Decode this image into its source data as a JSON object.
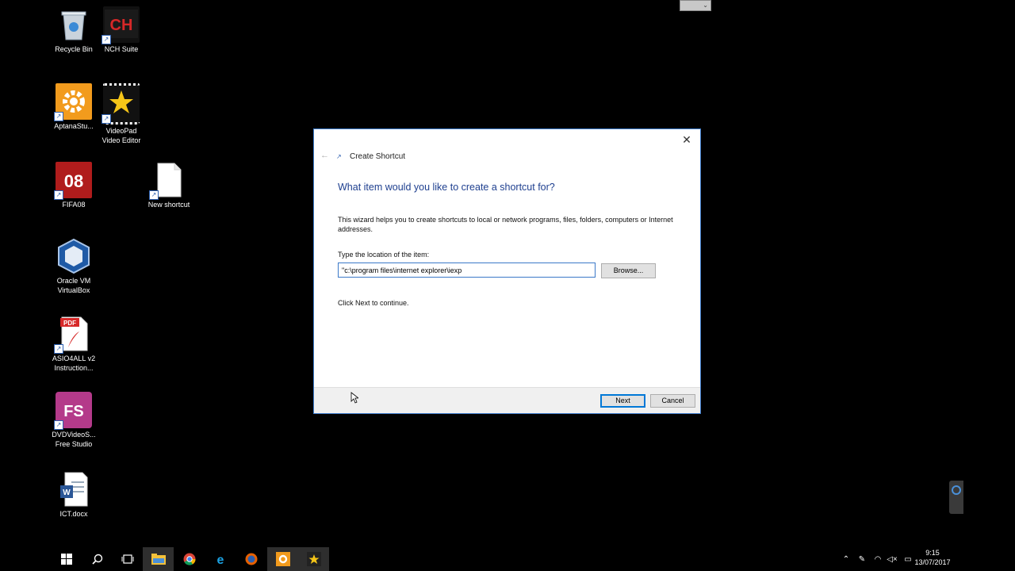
{
  "desktop": {
    "icons": [
      {
        "label": "Recycle Bin",
        "icon": "recycle-bin-icon"
      },
      {
        "label": "NCH Suite",
        "icon": "nch-suite-icon"
      },
      {
        "label": "AptanaStu...",
        "icon": "aptana-studio-icon"
      },
      {
        "label": "VideoPad\nVideo Editor",
        "icon": "videopad-icon"
      },
      {
        "label": "FIFA08",
        "icon": "fifa08-icon"
      },
      {
        "label": "New shortcut",
        "icon": "new-shortcut-icon"
      },
      {
        "label": "Oracle VM\nVirtualBox",
        "icon": "virtualbox-icon"
      },
      {
        "label": "ASIO4ALL v2\nInstruction...",
        "icon": "pdf-icon"
      },
      {
        "label": "DVDVideoS...\nFree Studio",
        "icon": "free-studio-icon"
      },
      {
        "label": "ICT.docx",
        "icon": "word-doc-icon"
      }
    ],
    "ncs_glyph": "CH",
    "fifa_glyph": "08",
    "pdf_glyph": "PDF",
    "fs_glyph": "FS",
    "word_glyph": "W"
  },
  "dialog": {
    "title": "Create Shortcut",
    "heading": "What item would you like to create a shortcut for?",
    "description": "This wizard helps you to create shortcuts to local or network programs, files, folders, computers or Internet addresses.",
    "location_label": "Type the location of the item:",
    "location_value": "\"c:\\program files\\internet explorer\\iexp",
    "browse_label": "Browse...",
    "continue_text": "Click Next to continue.",
    "next_label": "Next",
    "cancel_label": "Cancel",
    "close_glyph": "✕",
    "back_glyph": "←"
  },
  "taskbar": {
    "clock_time": "9:15",
    "clock_date": "13/07/2017",
    "buttons": [
      "start-icon",
      "search-icon",
      "task-view-icon",
      "file-explorer-icon",
      "chrome-icon",
      "internet-explorer-icon",
      "firefox-icon",
      "aptana-icon",
      "videopad-icon"
    ]
  },
  "colors": {
    "accent": "#0078d7",
    "heading": "#1e3f8f",
    "desktop_bg": "#000000"
  }
}
